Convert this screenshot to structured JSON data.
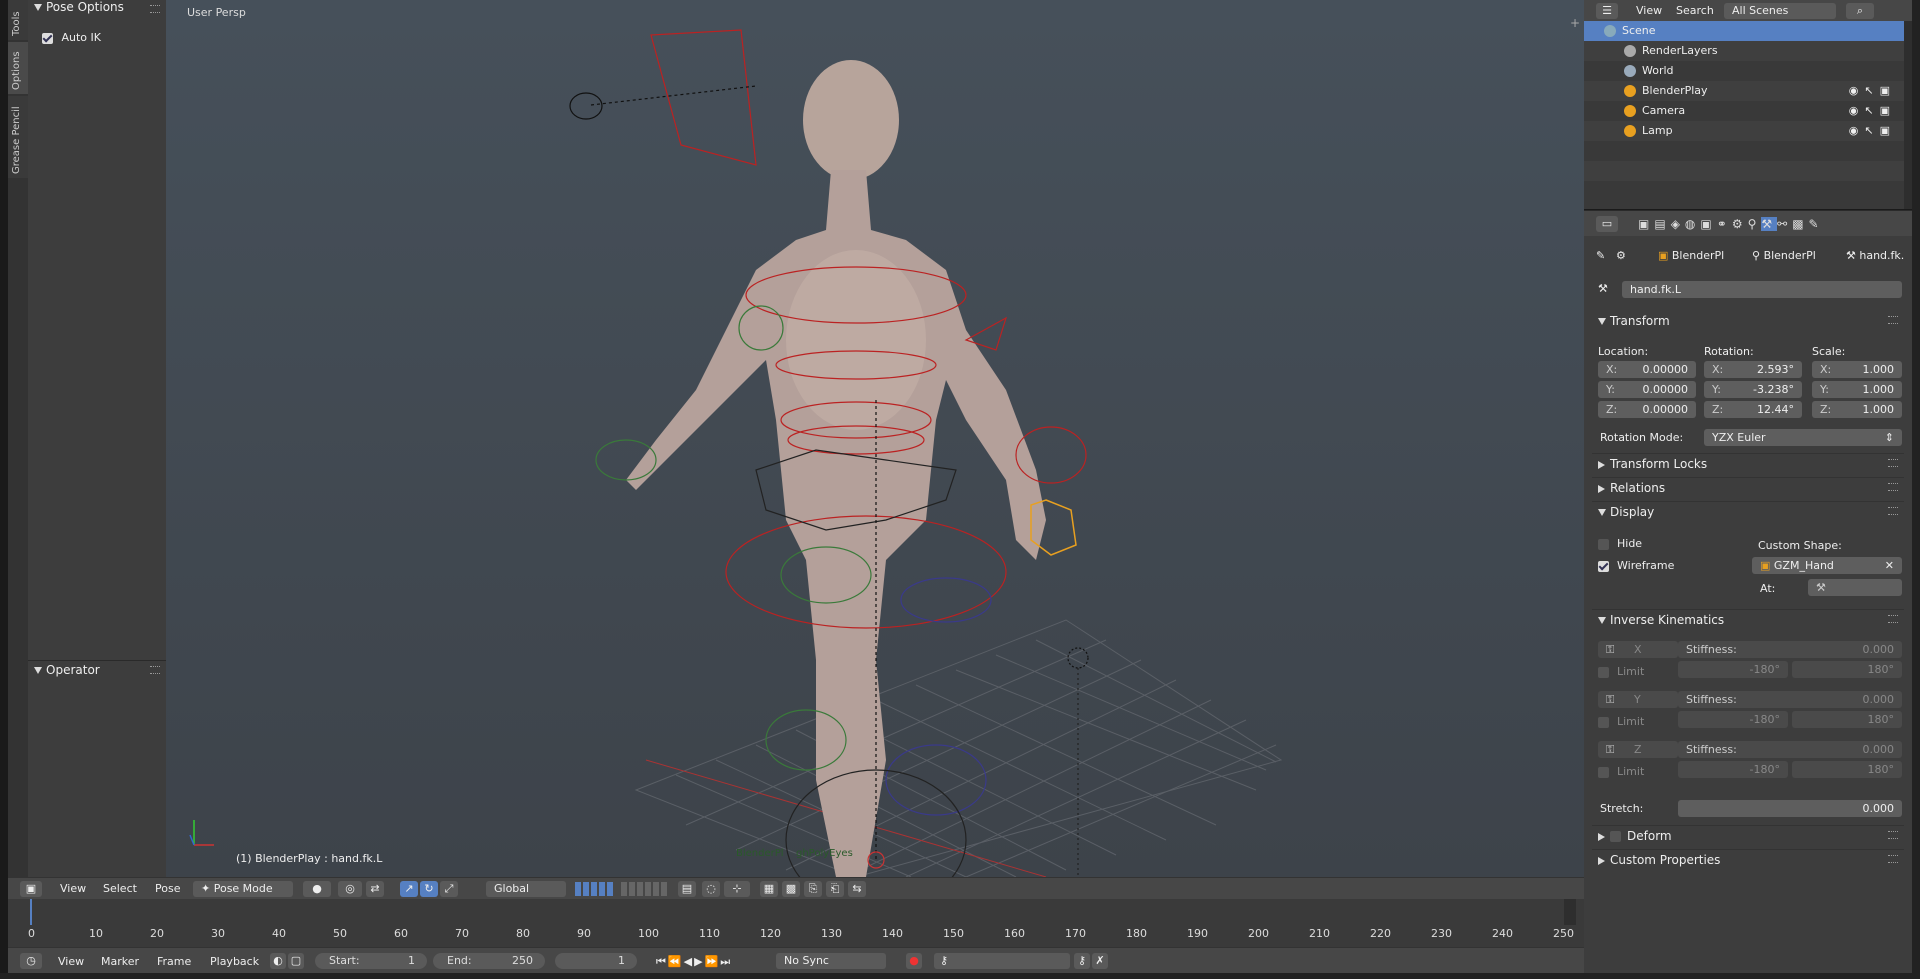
{
  "toolshelf": {
    "tabs": [
      "Tools",
      "Options",
      "Grease Pencil"
    ],
    "pose_options_title": "Pose Options",
    "auto_ik_label": "Auto IK",
    "auto_ik_checked": true,
    "operator_title": "Operator"
  },
  "viewport": {
    "view_name": "User Persp",
    "active_info": "(1) BlenderPlay : hand.fk.L",
    "overlay_labels": [
      "BlenderPl",
      "ghPolyEyes"
    ]
  },
  "view3d_header": {
    "menus": [
      "View",
      "Select",
      "Pose"
    ],
    "mode": "Pose Mode",
    "orientation": "Global"
  },
  "timeline": {
    "ruler_ticks": [
      "0",
      "10",
      "20",
      "30",
      "40",
      "50",
      "60",
      "70",
      "80",
      "90",
      "100",
      "110",
      "120",
      "130",
      "140",
      "150",
      "160",
      "170",
      "180",
      "190",
      "200",
      "210",
      "220",
      "230",
      "240",
      "250"
    ],
    "menus": [
      "View",
      "Marker",
      "Frame",
      "Playback"
    ],
    "start_label": "Start:",
    "start_value": "1",
    "end_label": "End:",
    "end_value": "250",
    "current_frame": "1",
    "sync": "No Sync"
  },
  "outliner": {
    "menus": [
      "View",
      "Search"
    ],
    "filter": "All Scenes",
    "rows": [
      {
        "label": "Scene",
        "indent": 0,
        "selected": true
      },
      {
        "label": "RenderLayers",
        "indent": 1
      },
      {
        "label": "World",
        "indent": 1
      },
      {
        "label": "BlenderPlay",
        "indent": 1
      },
      {
        "label": "Camera",
        "indent": 1
      },
      {
        "label": "Lamp",
        "indent": 1
      }
    ]
  },
  "properties": {
    "breadcrumb": [
      "BlenderPl",
      "BlenderPl",
      "hand.fk."
    ],
    "bone_name": "hand.fk.L",
    "transform": {
      "title": "Transform",
      "location_label": "Location:",
      "rotation_label": "Rotation:",
      "scale_label": "Scale:",
      "location": {
        "X": "0.00000",
        "Y": "0.00000",
        "Z": "0.00000"
      },
      "rotation": {
        "X": "2.593°",
        "Y": "-3.238°",
        "Z": "12.44°"
      },
      "scale": {
        "X": "1.000",
        "Y": "1.000",
        "Z": "1.000"
      },
      "rotation_mode_label": "Rotation Mode:",
      "rotation_mode": "YZX Euler"
    },
    "transform_locks_title": "Transform Locks",
    "relations_title": "Relations",
    "display": {
      "title": "Display",
      "hide_label": "Hide",
      "wireframe_label": "Wireframe",
      "custom_shape_label": "Custom Shape:",
      "custom_shape_value": "GZM_Hand",
      "at_label": "At:"
    },
    "ik": {
      "title": "Inverse Kinematics",
      "axes": [
        "X",
        "Y",
        "Z"
      ],
      "stiffness_label": "Stiffness:",
      "stiffness_value": "0.000",
      "limit_label": "Limit",
      "limit_min": "-180°",
      "limit_max": "180°",
      "stretch_label": "Stretch:",
      "stretch_value": "0.000"
    },
    "deform_title": "Deform",
    "custom_properties_title": "Custom Properties"
  }
}
